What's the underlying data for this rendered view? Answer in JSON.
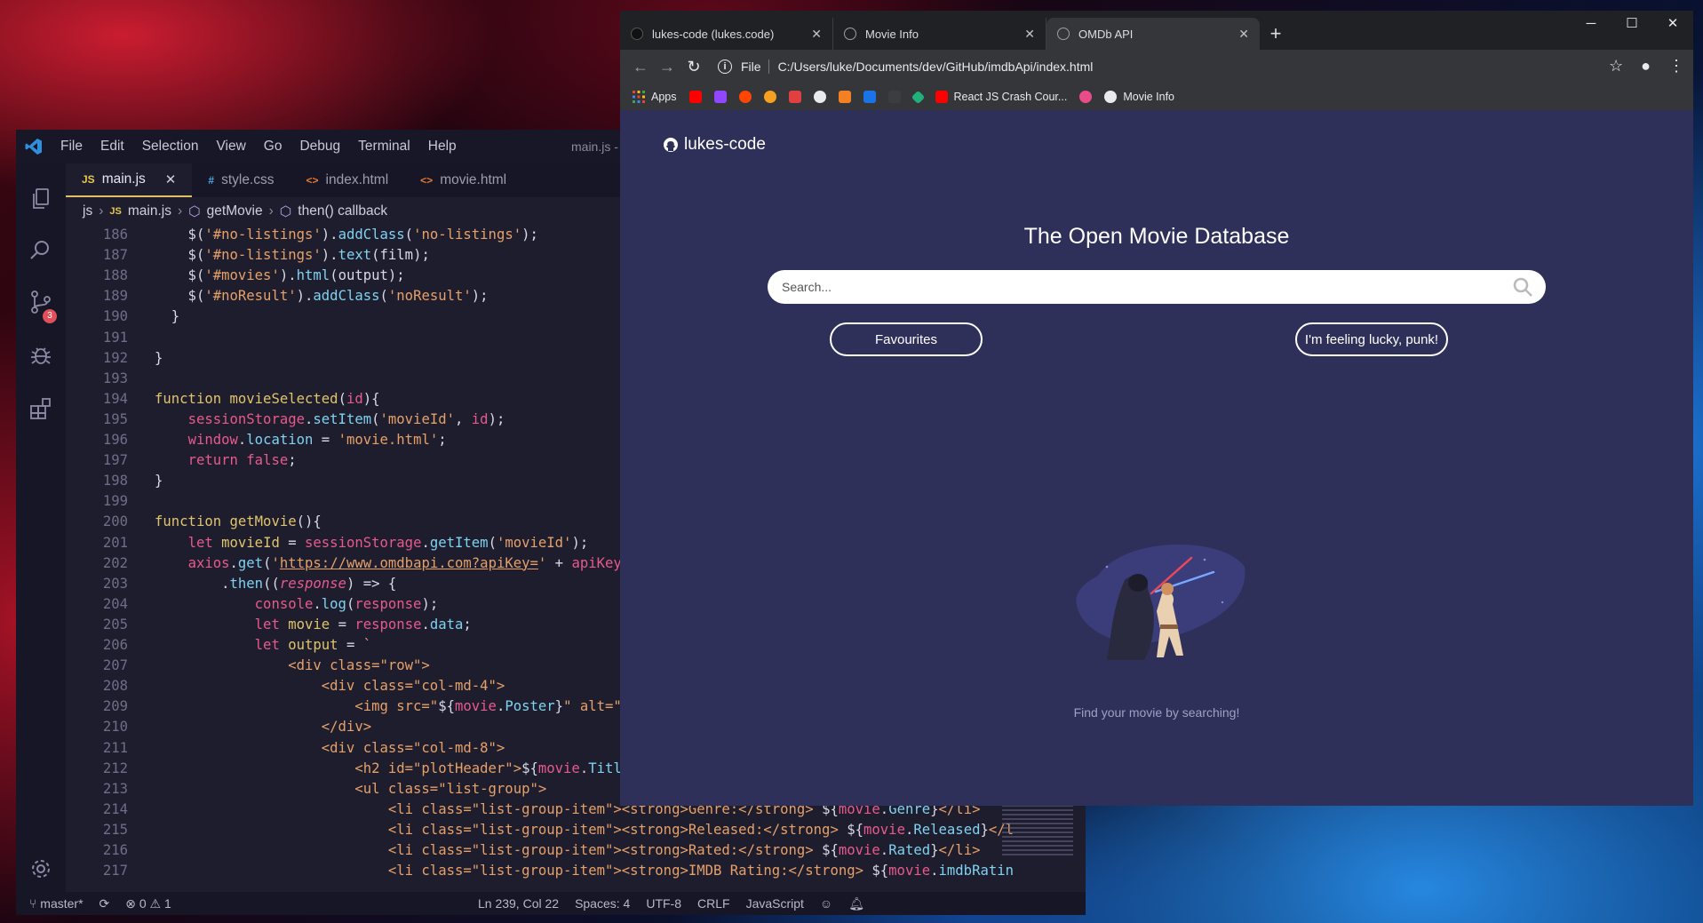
{
  "vscode": {
    "menu": [
      "File",
      "Edit",
      "Selection",
      "View",
      "Go",
      "Debug",
      "Terminal",
      "Help"
    ],
    "window_title": "main.js -",
    "tabs": [
      {
        "icon": "JS",
        "label": "main.js",
        "active": true
      },
      {
        "icon": "#",
        "label": "style.css"
      },
      {
        "icon": "<>",
        "label": "index.html"
      },
      {
        "icon": "<>",
        "label": "movie.html"
      }
    ],
    "breadcrumb": [
      "js",
      "main.js",
      "getMovie",
      "then() callback"
    ],
    "scm_badge": "3",
    "code_lines": [
      {
        "n": "186",
        "html": "    $(<span class=\"str\">'#no-listings'</span>).<span class=\"fn\">addClass</span>(<span class=\"str\">'no-listings'</span>);"
      },
      {
        "n": "187",
        "html": "    $(<span class=\"str\">'#no-listings'</span>).<span class=\"fn\">text</span>(film);"
      },
      {
        "n": "188",
        "html": "    $(<span class=\"str\">'#movies'</span>).<span class=\"fn\">html</span>(output);"
      },
      {
        "n": "189",
        "html": "    $(<span class=\"str\">'#noResult'</span>).<span class=\"fn\">addClass</span>(<span class=\"str\">'noResult'</span>);"
      },
      {
        "n": "190",
        "html": "  }"
      },
      {
        "n": "191",
        "html": ""
      },
      {
        "n": "192",
        "html": "}"
      },
      {
        "n": "193",
        "html": ""
      },
      {
        "n": "194",
        "html": "<span class=\"kw\">function</span> <span class=\"kw\">movieSelected</span>(<span class=\"vr\">id</span>){"
      },
      {
        "n": "195",
        "html": "    <span class=\"vr\">sessionStorage</span>.<span class=\"fn\">setItem</span>(<span class=\"str\">'movieId'</span>, <span class=\"vr\">id</span>);"
      },
      {
        "n": "196",
        "html": "    <span class=\"vr\">window</span>.<span class=\"fn\">location</span> = <span class=\"str\">'movie.html'</span>;"
      },
      {
        "n": "197",
        "html": "    <span class=\"vr\">return</span> <span class=\"vr\">false</span>;"
      },
      {
        "n": "198",
        "html": "}"
      },
      {
        "n": "199",
        "html": ""
      },
      {
        "n": "200",
        "html": "<span class=\"kw\">function</span> <span class=\"kw\">getMovie</span>(){"
      },
      {
        "n": "201",
        "html": "    <span class=\"vr\">let</span> <span class=\"kw\">movieId</span> = <span class=\"vr\">sessionStorage</span>.<span class=\"fn\">getItem</span>(<span class=\"str\">'movieId'</span>);"
      },
      {
        "n": "202",
        "html": "    <span class=\"vr\">axios</span>.<span class=\"fn\">get</span>(<span class=\"str\">'<u>https://www.omdbapi.com?apiKey=</u>'</span> + <span class=\"vr\">apiKey</span> +"
      },
      {
        "n": "203",
        "html": "        .<span class=\"fn\">then</span>((<span class=\"vr\"><i>response</i></span>) => {"
      },
      {
        "n": "204",
        "html": "            <span class=\"vr\">console</span>.<span class=\"fn\">log</span>(<span class=\"vr\">response</span>);"
      },
      {
        "n": "205",
        "html": "            <span class=\"vr\">let</span> <span class=\"kw\">movie</span> = <span class=\"vr\">response</span>.<span class=\"fn\">data</span>;"
      },
      {
        "n": "206",
        "html": "            <span class=\"vr\">let</span> <span class=\"kw\">output</span> = <span class=\"str\">`</span>"
      },
      {
        "n": "207",
        "html": "<span class=\"str\">                &lt;div class=\"row\"&gt;</span>"
      },
      {
        "n": "208",
        "html": "<span class=\"str\">                    &lt;div class=\"col-md-4\"&gt;</span>"
      },
      {
        "n": "209",
        "html": "<span class=\"str\">                        &lt;img src=\"</span>${<span class=\"vr\">movie</span>.<span class=\"fn\">Poster</span>}<span class=\"str\">\" alt=\"</span>${<span class=\"vr\">m</span>"
      },
      {
        "n": "210",
        "html": "<span class=\"str\">                    &lt;/div&gt;</span>"
      },
      {
        "n": "211",
        "html": "<span class=\"str\">                    &lt;div class=\"col-md-8\"&gt;</span>"
      },
      {
        "n": "212",
        "html": "<span class=\"str\">                        &lt;h2 id=\"plotHeader\"&gt;</span>${<span class=\"vr\">movie</span>.<span class=\"fn\">Title</span>}<span class=\"str\">&lt;</span>"
      },
      {
        "n": "213",
        "html": "<span class=\"str\">                        &lt;ul class=\"list-group\"&gt;</span>"
      },
      {
        "n": "214",
        "html": "<span class=\"str\">                            &lt;li class=\"list-group-item\"&gt;&lt;strong&gt;Genre:&lt;/strong&gt; </span>${<span class=\"vr\">movie</span>.<span class=\"fn\">Genre</span>}<span class=\"str\">&lt;/li&gt;</span>"
      },
      {
        "n": "215",
        "html": "<span class=\"str\">                            &lt;li class=\"list-group-item\"&gt;&lt;strong&gt;Released:&lt;/strong&gt; </span>${<span class=\"vr\">movie</span>.<span class=\"fn\">Released</span>}<span class=\"str\">&lt;/l</span>"
      },
      {
        "n": "216",
        "html": "<span class=\"str\">                            &lt;li class=\"list-group-item\"&gt;&lt;strong&gt;Rated:&lt;/strong&gt; </span>${<span class=\"vr\">movie</span>.<span class=\"fn\">Rated</span>}<span class=\"str\">&lt;/li&gt;</span>"
      },
      {
        "n": "217",
        "html": "<span class=\"str\">                            &lt;li class=\"list-group-item\"&gt;&lt;strong&gt;IMDB Rating:&lt;/strong&gt; </span>${<span class=\"vr\">movie</span>.<span class=\"fn\">imdbRatin</span>"
      }
    ],
    "status": {
      "branch": "master*",
      "problems": "⊗ 0 ⚠ 1",
      "position": "Ln 239, Col 22",
      "spaces": "Spaces: 4",
      "encoding": "UTF-8",
      "eol": "CRLF",
      "language": "JavaScript"
    }
  },
  "chrome": {
    "tabs": [
      {
        "title": "lukes-code (lukes.code)"
      },
      {
        "title": "Movie Info"
      },
      {
        "title": "OMDb API",
        "active": true
      }
    ],
    "url_scheme": "File",
    "url": "C:/Users/luke/Documents/dev/GitHub/imdbApi/index.html",
    "bookmarks": {
      "apps": "Apps",
      "react": "React JS Crash Cour...",
      "movie_info": "Movie Info"
    }
  },
  "site": {
    "brand": "lukes-code",
    "title": "The Open Movie Database",
    "search_placeholder": "Search...",
    "favourites_label": "Favourites",
    "lucky_label": "I'm feeling lucky, punk!",
    "empty_message": "Find your movie by searching!"
  },
  "colors": {
    "page_bg": "#2e3059",
    "editor_bg": "#1e1d2e",
    "accent_tab": "#e0c060"
  }
}
